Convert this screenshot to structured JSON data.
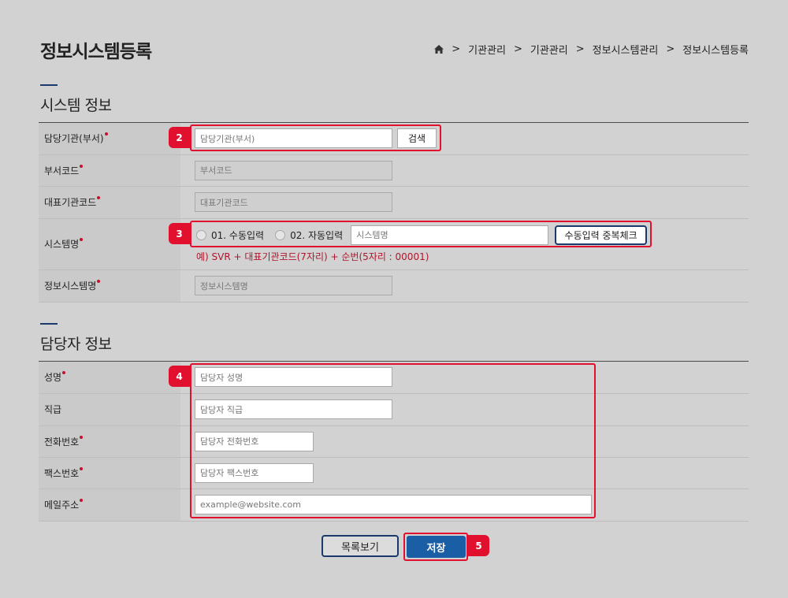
{
  "page_title": "정보시스템등록",
  "breadcrumb": [
    "기관관리",
    "기관관리",
    "정보시스템관리",
    "정보시스템등록"
  ],
  "sections": {
    "system_info": {
      "title": "시스템 정보",
      "rows": {
        "dept": {
          "label": "담당기관(부서)",
          "placeholder": "담당기관(부서)",
          "button": "검색"
        },
        "dept_code": {
          "label": "부서코드",
          "placeholder": "부서코드"
        },
        "rep_code": {
          "label": "대표기관코드",
          "placeholder": "대표기관코드"
        },
        "system_name": {
          "label": "시스템명",
          "radio1": "01. 수동입력",
          "radio2": "02. 자동입력",
          "placeholder": "시스템명",
          "button": "수동입력 중복체크",
          "hint": "예) SVR + 대표기관코드(7자리) + 순번(5자리 : 00001)"
        },
        "info_system_name": {
          "label": "정보시스템명",
          "placeholder": "정보시스템명"
        }
      }
    },
    "manager_info": {
      "title": "담당자 정보",
      "rows": {
        "name": {
          "label": "성명",
          "placeholder": "담당자 성명"
        },
        "rank": {
          "label": "직급",
          "placeholder": "담당자 직급"
        },
        "phone": {
          "label": "전화번호",
          "placeholder": "담당자 전화번호"
        },
        "fax": {
          "label": "팩스번호",
          "placeholder": "담당자 팩스번호"
        },
        "email": {
          "label": "메일주소",
          "placeholder": "example@website.com"
        }
      }
    }
  },
  "buttons": {
    "list": "목록보기",
    "save": "저장"
  },
  "badges": {
    "b2": "2",
    "b3": "3",
    "b4": "4",
    "b5": "5"
  },
  "colors": {
    "accent": "#1a3a6b",
    "highlight": "#e0102e",
    "save": "#1a5fa6"
  }
}
